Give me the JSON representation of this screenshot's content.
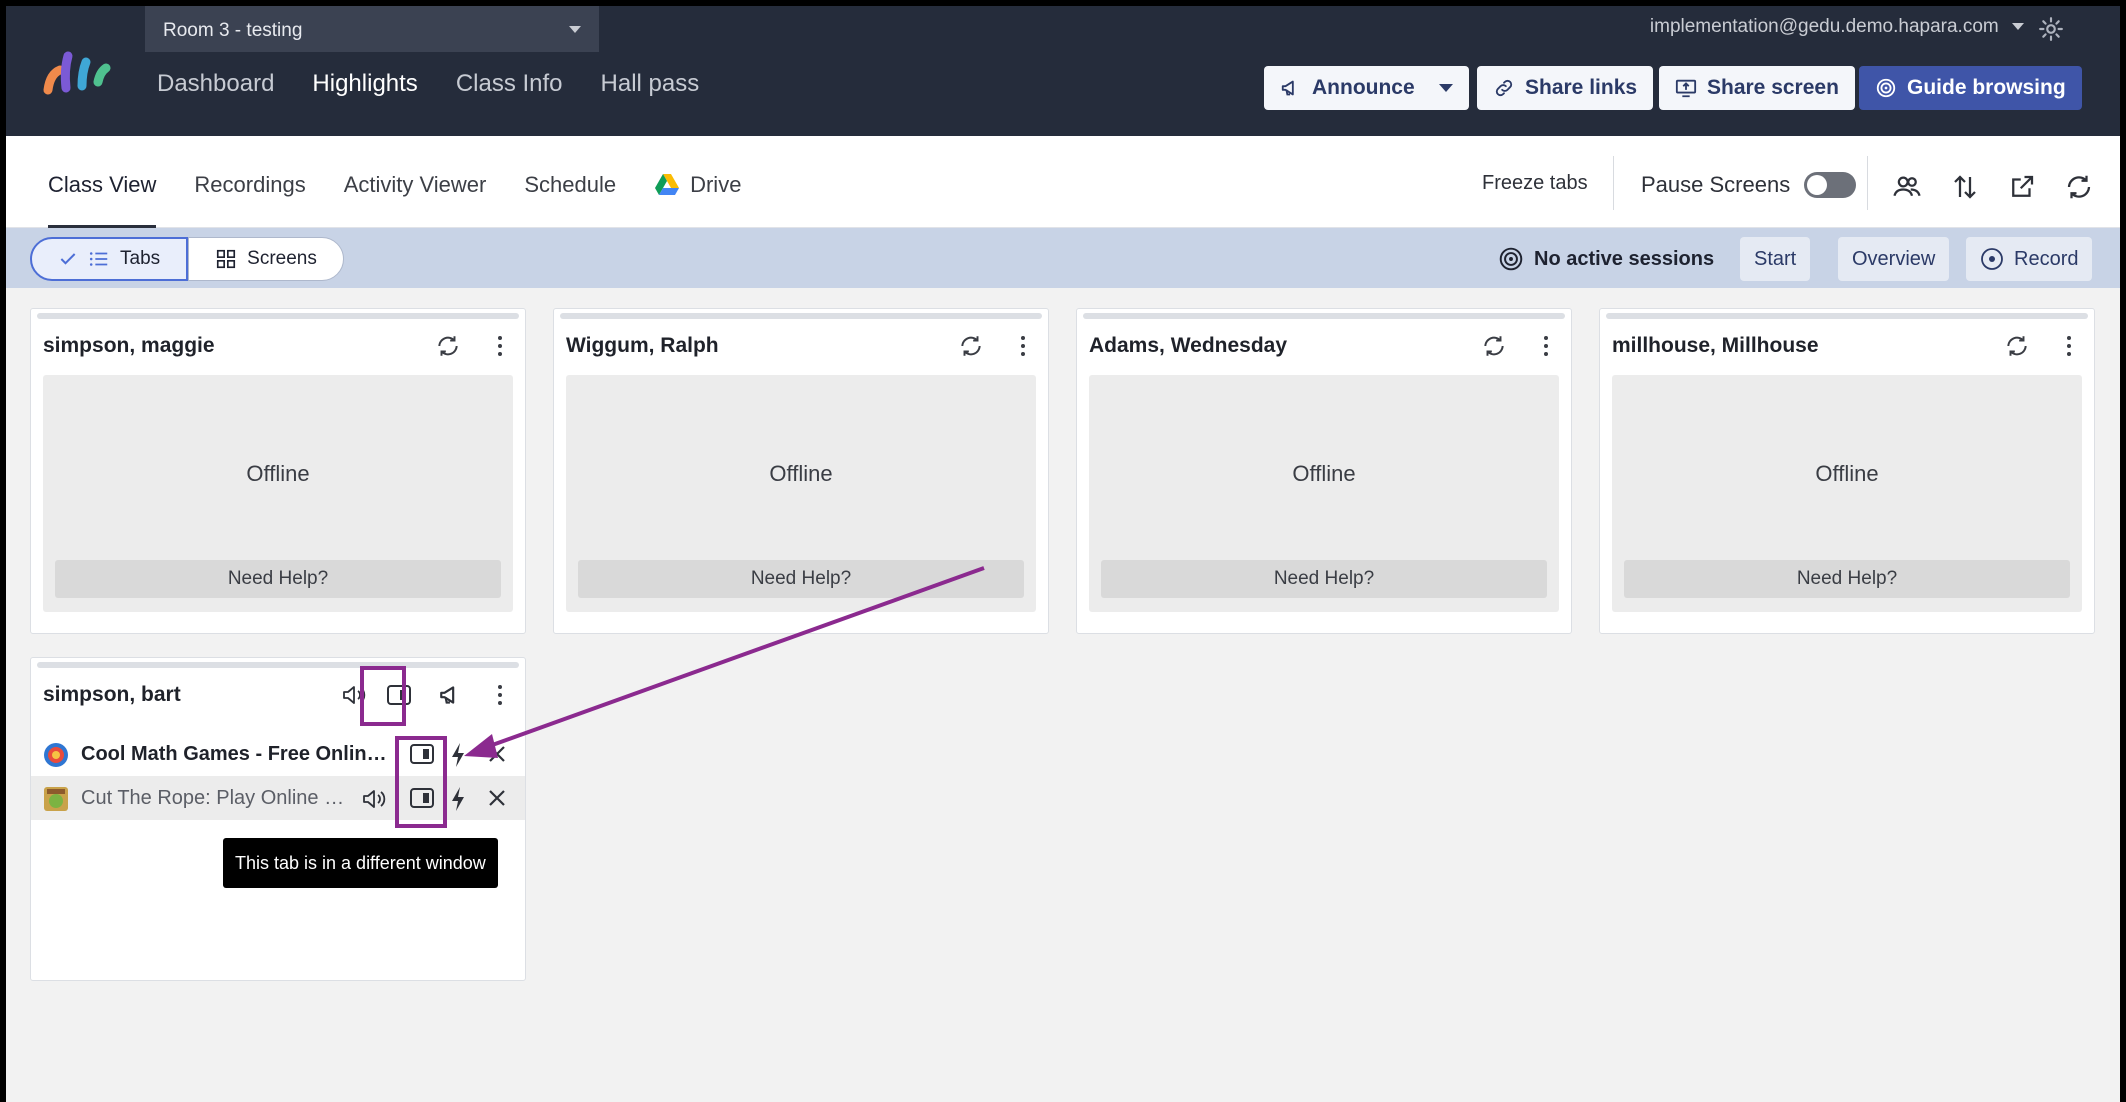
{
  "room": {
    "label": "Room 3 - testing"
  },
  "nav": {
    "items": [
      "Dashboard",
      "Highlights",
      "Class Info",
      "Hall pass"
    ],
    "active": "Highlights"
  },
  "account": {
    "email": "implementation@gedu.demo.hapara.com"
  },
  "actions": {
    "announce": "Announce",
    "share_links": "Share links",
    "share_screen": "Share screen",
    "guide_browsing": "Guide browsing"
  },
  "subtabs": {
    "class_view": "Class View",
    "recordings": "Recordings",
    "activity_viewer": "Activity Viewer",
    "schedule": "Schedule",
    "drive": "Drive"
  },
  "toolbar": {
    "freeze_tabs": "Freeze tabs",
    "pause_screens": "Pause Screens",
    "pause_enabled": false
  },
  "filter": {
    "tabs": "Tabs",
    "screens": "Screens",
    "sessions": "No active sessions",
    "start": "Start",
    "overview": "Overview",
    "record": "Record"
  },
  "students": [
    {
      "name": "simpson, maggie",
      "status": "Offline",
      "help": "Need Help?"
    },
    {
      "name": "Wiggum, Ralph",
      "status": "Offline",
      "help": "Need Help?"
    },
    {
      "name": "Adams, Wednesday",
      "status": "Offline",
      "help": "Need Help?"
    },
    {
      "name": "millhouse, Millhouse",
      "status": "Offline",
      "help": "Need Help?"
    }
  ],
  "active_student": {
    "name": "simpson, bart",
    "tabs": [
      {
        "title": "Cool Math Games - Free Online Games",
        "active": true,
        "audio": false
      },
      {
        "title": "Cut The Rope: Play Online For Free",
        "active": false,
        "audio": true
      }
    ],
    "tooltip": "This tab is in a different window"
  },
  "colors": {
    "topbar": "#252c3b",
    "primary": "#3f55a8",
    "annotation": "#8b2a8f",
    "filterbar": "#c8d3e6"
  }
}
